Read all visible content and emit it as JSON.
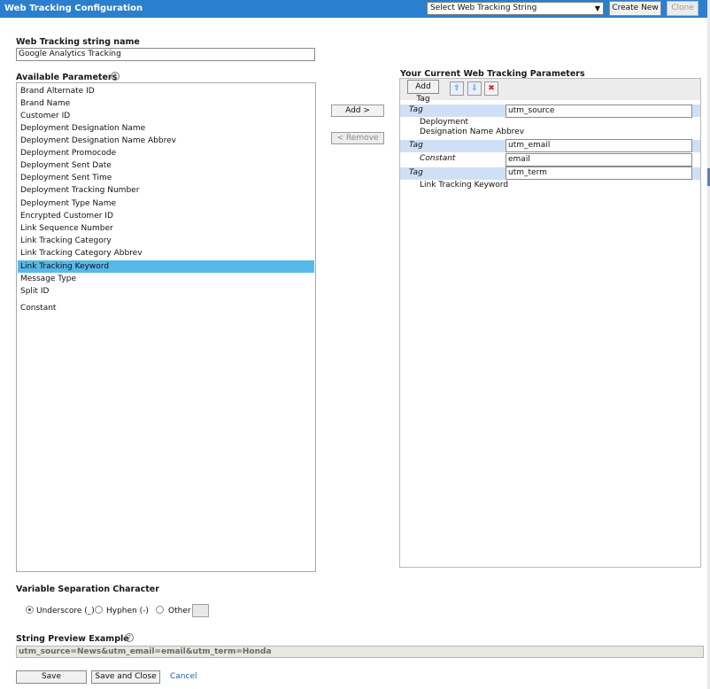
{
  "header": {
    "title": "Web Tracking Configuration",
    "select_value": "Select Web Tracking String",
    "create_new_label": "Create New",
    "clone_label": "Clone"
  },
  "name_section": {
    "label": "Web Tracking string name",
    "value": "Google Analytics Tracking"
  },
  "available": {
    "label": "Available Parameters",
    "help": "?",
    "items": [
      "Brand Alternate ID",
      "Brand Name",
      "Customer ID",
      "Deployment Designation Name",
      "Deployment Designation Name Abbrev",
      "Deployment Promocode",
      "Deployment Sent Date",
      "Deployment Sent Time",
      "Deployment Tracking Number",
      "Deployment Type Name",
      "Encrypted Customer ID",
      "Link Sequence Number",
      "Link Tracking Category",
      "Link Tracking Category Abbrev",
      "Link Tracking Keyword",
      "Message Type",
      "Split ID",
      "Constant"
    ],
    "selected": "Link Tracking Keyword"
  },
  "actions": {
    "add_label": "Add  >",
    "remove_label": "<  Remove"
  },
  "current": {
    "label": "Your Current Web Tracking Parameters",
    "add_tag_label": "Add Tag",
    "move_up_glyph": "⇧",
    "move_down_glyph": "⇩",
    "delete_glyph": "✖",
    "tag_label": "Tag",
    "constant_label": "Constant",
    "rows": [
      {
        "tag_value": "utm_source",
        "param_line1": "Deployment",
        "param_line2": "Designation Name Abbrev"
      },
      {
        "tag_value": "utm_email",
        "constant_value": "email"
      },
      {
        "tag_value": "utm_term",
        "param_line1": "Link Tracking Keyword"
      }
    ]
  },
  "separation": {
    "label": "Variable Separation Character",
    "options": [
      "Underscore (_)",
      "Hyphen (-)",
      "Other"
    ],
    "selected": "Underscore (_)"
  },
  "preview": {
    "label": "String Preview Example",
    "help": "?",
    "value": "utm_source=News&utm_email=email&utm_term=Honda"
  },
  "footer": {
    "save_label": "Save",
    "save_close_label": "Save and Close",
    "cancel_label": "Cancel"
  }
}
